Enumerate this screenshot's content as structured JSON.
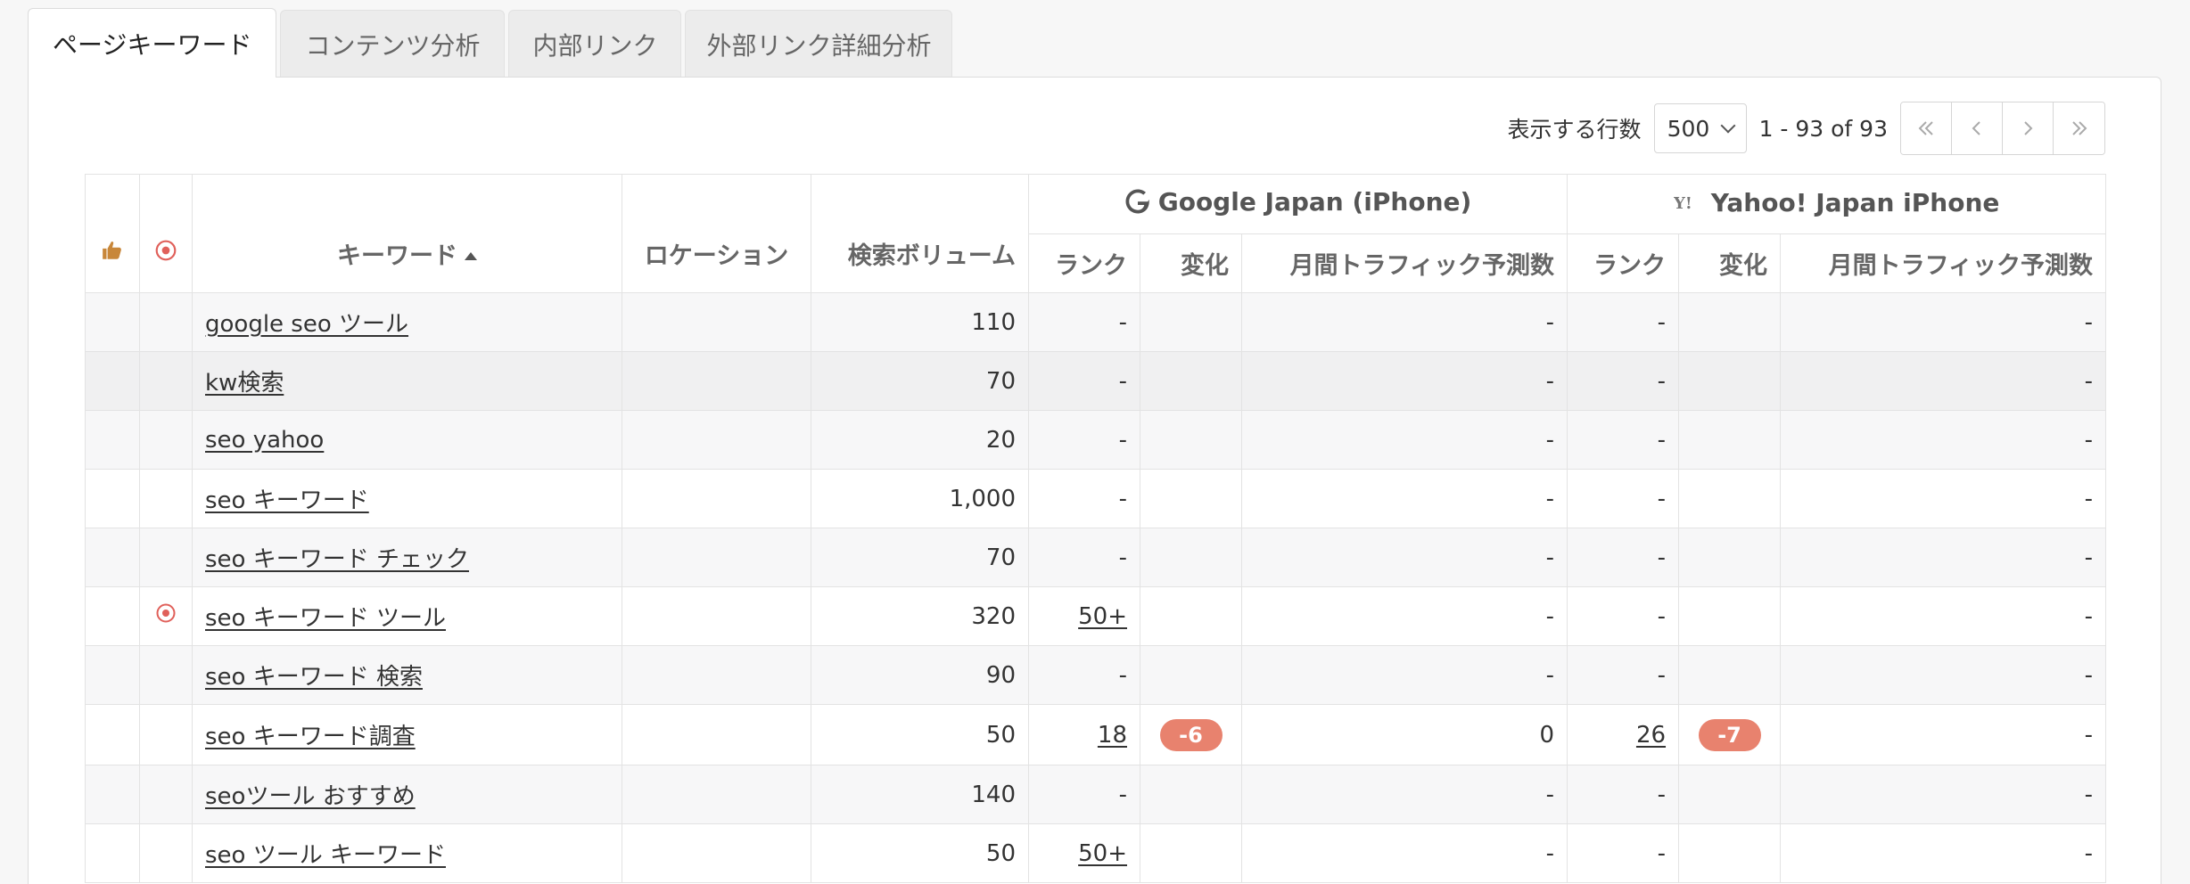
{
  "tabs": [
    {
      "label": "ページキーワード",
      "active": true
    },
    {
      "label": "コンテンツ分析",
      "active": false
    },
    {
      "label": "内部リンク",
      "active": false
    },
    {
      "label": "外部リンク詳細分析",
      "active": false
    }
  ],
  "toolbar": {
    "rows_label": "表示する行数",
    "rows_value": "500",
    "range_text": "1 - 93 of 93"
  },
  "engines": {
    "google": "Google Japan (iPhone)",
    "yahoo": "Yahoo! Japan iPhone"
  },
  "columns": {
    "keyword": "キーワード",
    "location": "ロケーション",
    "volume": "検索ボリューム",
    "rank": "ランク",
    "change": "変化",
    "traffic": "月間トラフィック予測数"
  },
  "colors": {
    "badge": "#e8826e",
    "target_icon": "#e0605a",
    "thumb_icon": "#c8873a"
  },
  "rows": [
    {
      "target": false,
      "keyword": "google seo ツール",
      "location": "",
      "volume": "110",
      "g_rank": "-",
      "g_rank_link": false,
      "g_change": "",
      "g_traffic": "-",
      "y_rank": "-",
      "y_rank_link": false,
      "y_change": "",
      "y_traffic": "-"
    },
    {
      "target": false,
      "keyword": "kw検索",
      "location": "",
      "volume": "70",
      "g_rank": "-",
      "g_rank_link": false,
      "g_change": "",
      "g_traffic": "-",
      "y_rank": "-",
      "y_rank_link": false,
      "y_change": "",
      "y_traffic": "-"
    },
    {
      "target": false,
      "keyword": "seo yahoo",
      "location": "",
      "volume": "20",
      "g_rank": "-",
      "g_rank_link": false,
      "g_change": "",
      "g_traffic": "-",
      "y_rank": "-",
      "y_rank_link": false,
      "y_change": "",
      "y_traffic": "-"
    },
    {
      "target": false,
      "keyword": "seo キーワード",
      "location": "",
      "volume": "1,000",
      "g_rank": "-",
      "g_rank_link": false,
      "g_change": "",
      "g_traffic": "-",
      "y_rank": "-",
      "y_rank_link": false,
      "y_change": "",
      "y_traffic": "-"
    },
    {
      "target": false,
      "keyword": "seo キーワード チェック",
      "location": "",
      "volume": "70",
      "g_rank": "-",
      "g_rank_link": false,
      "g_change": "",
      "g_traffic": "-",
      "y_rank": "-",
      "y_rank_link": false,
      "y_change": "",
      "y_traffic": "-"
    },
    {
      "target": true,
      "keyword": "seo キーワード ツール",
      "location": "",
      "volume": "320",
      "g_rank": "50+",
      "g_rank_link": true,
      "g_change": "",
      "g_traffic": "-",
      "y_rank": "-",
      "y_rank_link": false,
      "y_change": "",
      "y_traffic": "-"
    },
    {
      "target": false,
      "keyword": "seo キーワード 検索",
      "location": "",
      "volume": "90",
      "g_rank": "-",
      "g_rank_link": false,
      "g_change": "",
      "g_traffic": "-",
      "y_rank": "-",
      "y_rank_link": false,
      "y_change": "",
      "y_traffic": "-"
    },
    {
      "target": false,
      "keyword": "seo キーワード調査",
      "location": "",
      "volume": "50",
      "g_rank": "18",
      "g_rank_link": true,
      "g_change": "-6",
      "g_traffic": "0",
      "y_rank": "26",
      "y_rank_link": true,
      "y_change": "-7",
      "y_traffic": "-"
    },
    {
      "target": false,
      "keyword": "seoツール おすすめ",
      "location": "",
      "volume": "140",
      "g_rank": "-",
      "g_rank_link": false,
      "g_change": "",
      "g_traffic": "-",
      "y_rank": "-",
      "y_rank_link": false,
      "y_change": "",
      "y_traffic": "-"
    },
    {
      "target": false,
      "keyword": "seo ツール キーワード",
      "location": "",
      "volume": "50",
      "g_rank": "50+",
      "g_rank_link": true,
      "g_change": "",
      "g_traffic": "-",
      "y_rank": "-",
      "y_rank_link": false,
      "y_change": "",
      "y_traffic": "-"
    }
  ]
}
